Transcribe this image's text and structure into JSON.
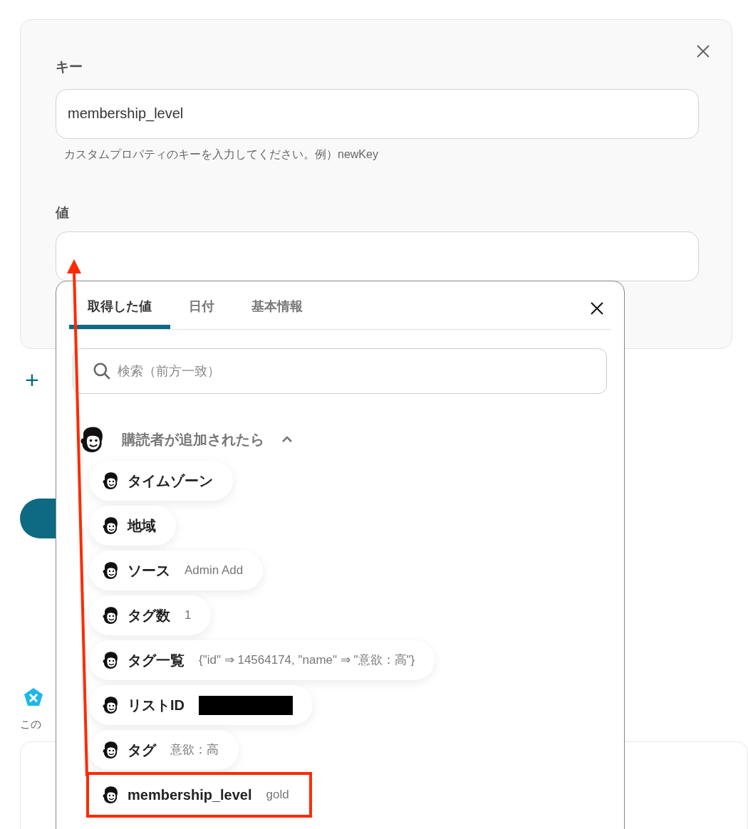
{
  "form": {
    "key_label": "キー",
    "key_value": "membership_level",
    "key_help": "カスタムプロパティのキーを入力してください。例）newKey",
    "value_label": "値"
  },
  "behind": {
    "add_symbol": "+",
    "note": "この"
  },
  "picker": {
    "tabs": [
      {
        "label": "取得した値",
        "selected": true
      },
      {
        "label": "日付",
        "selected": false
      },
      {
        "label": "基本情報",
        "selected": false
      }
    ],
    "search": {
      "placeholder": "検索（前方一致）"
    },
    "section": {
      "title": "購読者が追加されたら",
      "expanded": true
    },
    "items": [
      {
        "label": "タイムゾーン",
        "redacted": false,
        "annotated": false
      },
      {
        "label": "地域",
        "redacted": false,
        "annotated": false
      },
      {
        "label": "ソース",
        "value": "Admin Add",
        "redacted": false,
        "annotated": false
      },
      {
        "label": "タグ数",
        "value": "1",
        "redacted": false,
        "annotated": false
      },
      {
        "label": "タグ一覧",
        "value": "{\"id\" ⇒ 14564174, \"name\" ⇒ \"意欲：高\"}",
        "redacted": false,
        "annotated": false
      },
      {
        "label": "リストID",
        "redacted": true,
        "annotated": false
      },
      {
        "label": "タグ",
        "value": "意欲：高",
        "redacted": false,
        "annotated": false
      },
      {
        "label": "membership_level",
        "value": "gold",
        "redacted": false,
        "annotated": true
      }
    ]
  }
}
